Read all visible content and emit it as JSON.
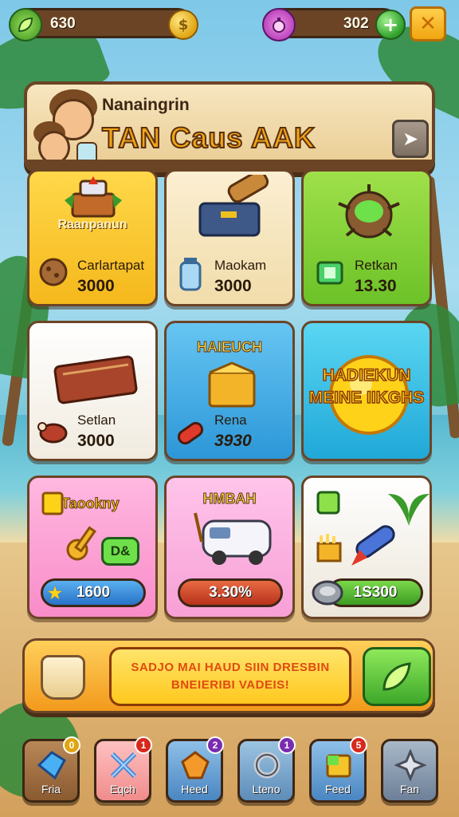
{
  "top_bar": {
    "left_resource": {
      "value": "630",
      "icon": "leaf-icon",
      "end_icon": "coin-icon"
    },
    "right_resource": {
      "value": "302",
      "icon": "potion-icon",
      "end_icon": "gem-plus-icon"
    },
    "close_icon": "close-icon"
  },
  "banner": {
    "subtitle": "Nanaingrin",
    "title": "TAN Caus AAK",
    "arrow_icon": "arrow-right-icon"
  },
  "cards": [
    {
      "head": "Raanpanun",
      "name": "Carlartapat",
      "price": "3000",
      "icon": "cake-stand-icon"
    },
    {
      "name": "Maokam",
      "price": "3000",
      "icon": "cannon-crate-icon"
    },
    {
      "name": "Retkan",
      "price": "13.30",
      "icon": "potion-pot-icon"
    },
    {
      "name": "Setlan",
      "price": "3000",
      "icon": "chest-icon"
    },
    {
      "head": "HAIEUCH",
      "name": "Rena",
      "price": "3930",
      "icon": "golden-box-icon"
    },
    {
      "head": "HADIEKUN MEINE IIKGHS",
      "icon": "sun-burst-icon"
    },
    {
      "head": "Taookny",
      "badge": "D&",
      "price": "1600",
      "icon": "key-icon"
    },
    {
      "head": "HMBAH",
      "price": "3.30%",
      "icon": "van-icon"
    },
    {
      "price": "1S300",
      "icon": "rocket-icon"
    }
  ],
  "promo": {
    "line1": "SADJO MAI HAUD SIIN DRESBIN",
    "line2": "BNEIERIBI VADEIS!",
    "icon": "cup-icon",
    "go_icon": "leaf-arrow-icon"
  },
  "nav": [
    {
      "label": "Fria",
      "badge": "0",
      "badge_color": "#e0a512",
      "icon": "blue-gem-icon"
    },
    {
      "label": "Eqch",
      "badge": "1",
      "badge_color": "#d8281c",
      "icon": "crossed-swords-icon"
    },
    {
      "label": "Heed",
      "badge": "2",
      "badge_color": "#7a2cb0",
      "icon": "orange-gem-icon"
    },
    {
      "label": "Lteno",
      "badge": "1",
      "badge_color": "#7a2cb0",
      "icon": "ring-icon"
    },
    {
      "label": "Feed",
      "badge": "5",
      "badge_color": "#d8281c",
      "icon": "cube-icon"
    },
    {
      "label": "Fan",
      "icon": "star-icon"
    }
  ]
}
